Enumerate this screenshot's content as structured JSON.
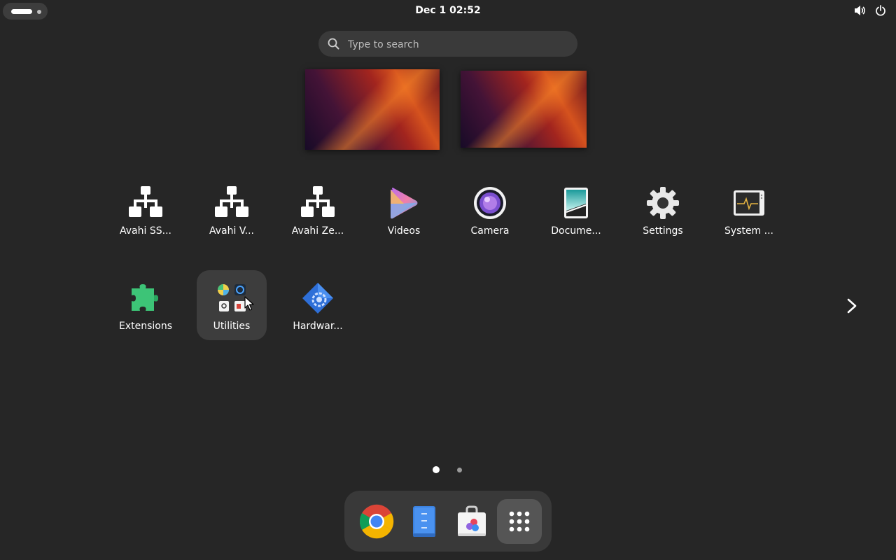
{
  "topbar": {
    "clock": "Dec 1  02:52",
    "icons": [
      "activities-indicator",
      "volume-icon",
      "power-icon"
    ]
  },
  "search": {
    "placeholder": "Type to search"
  },
  "workspaces": [
    {
      "name": "workspace-1"
    },
    {
      "name": "workspace-2"
    }
  ],
  "apps": [
    {
      "label": "Avahi SS...",
      "icon": "network-icon"
    },
    {
      "label": "Avahi V...",
      "icon": "network-icon"
    },
    {
      "label": "Avahi Ze...",
      "icon": "network-icon"
    },
    {
      "label": "Videos",
      "icon": "videos-icon"
    },
    {
      "label": "Camera",
      "icon": "camera-icon"
    },
    {
      "label": "Docume...",
      "icon": "document-scanner-icon"
    },
    {
      "label": "Settings",
      "icon": "gear-icon"
    },
    {
      "label": "System ...",
      "icon": "system-monitor-icon"
    },
    {
      "label": "Extensions",
      "icon": "puzzle-icon"
    },
    {
      "label": "Utilities",
      "icon": "folder-utilities-icon",
      "selected": true
    },
    {
      "label": "Hardwar...",
      "icon": "hardware-icon"
    }
  ],
  "pager": {
    "pages": 2,
    "current": 1
  },
  "dock": [
    {
      "name": "chrome",
      "icon": "chrome-icon"
    },
    {
      "name": "text-editor",
      "icon": "text-editor-icon"
    },
    {
      "name": "software",
      "icon": "software-store-icon"
    },
    {
      "name": "show-apps",
      "icon": "app-grid-icon",
      "active": true
    }
  ]
}
